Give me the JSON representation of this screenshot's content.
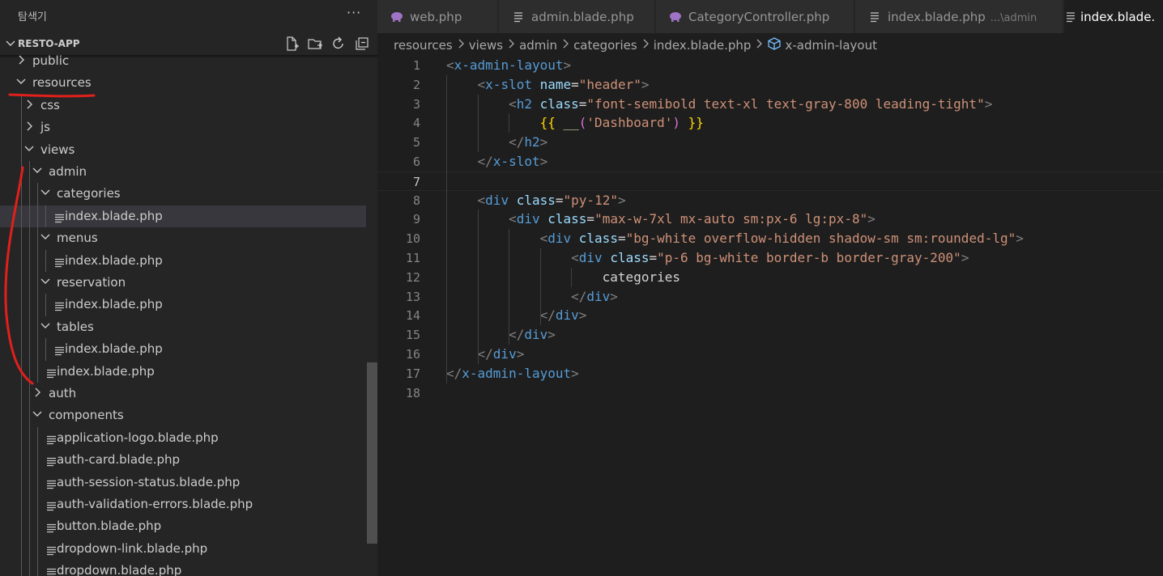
{
  "sidebar": {
    "explorer_title": "탐색기",
    "more_actions": "···",
    "project_name": "RESTO-APP",
    "project_actions": [
      "new-file-icon",
      "new-folder-icon",
      "refresh-icon",
      "collapse-all-icon"
    ],
    "tree": [
      {
        "label": "public",
        "type": "folder",
        "expanded": false,
        "depth": 0
      },
      {
        "label": "resources",
        "type": "folder",
        "expanded": true,
        "depth": 0
      },
      {
        "label": "css",
        "type": "folder",
        "expanded": false,
        "depth": 1
      },
      {
        "label": "js",
        "type": "folder",
        "expanded": false,
        "depth": 1
      },
      {
        "label": "views",
        "type": "folder",
        "expanded": true,
        "depth": 1
      },
      {
        "label": "admin",
        "type": "folder",
        "expanded": true,
        "depth": 2
      },
      {
        "label": "categories",
        "type": "folder",
        "expanded": true,
        "depth": 3
      },
      {
        "label": "index.blade.php",
        "type": "file",
        "depth": 4,
        "selected": true
      },
      {
        "label": "menus",
        "type": "folder",
        "expanded": true,
        "depth": 3
      },
      {
        "label": "index.blade.php",
        "type": "file",
        "depth": 4
      },
      {
        "label": "reservation",
        "type": "folder",
        "expanded": true,
        "depth": 3
      },
      {
        "label": "index.blade.php",
        "type": "file",
        "depth": 4
      },
      {
        "label": "tables",
        "type": "folder",
        "expanded": true,
        "depth": 3
      },
      {
        "label": "index.blade.php",
        "type": "file",
        "depth": 4
      },
      {
        "label": "index.blade.php",
        "type": "file",
        "depth": 3
      },
      {
        "label": "auth",
        "type": "folder",
        "expanded": false,
        "depth": 2
      },
      {
        "label": "components",
        "type": "folder",
        "expanded": true,
        "depth": 2
      },
      {
        "label": "application-logo.blade.php",
        "type": "file",
        "depth": 3
      },
      {
        "label": "auth-card.blade.php",
        "type": "file",
        "depth": 3
      },
      {
        "label": "auth-session-status.blade.php",
        "type": "file",
        "depth": 3
      },
      {
        "label": "auth-validation-errors.blade.php",
        "type": "file",
        "depth": 3
      },
      {
        "label": "button.blade.php",
        "type": "file",
        "depth": 3
      },
      {
        "label": "dropdown-link.blade.php",
        "type": "file",
        "depth": 3
      },
      {
        "label": "dropdown.blade.php",
        "type": "file",
        "depth": 3
      }
    ]
  },
  "tabs": [
    {
      "label": "web.php",
      "icon": "php-elephant-icon",
      "description": "",
      "active": false
    },
    {
      "label": "admin.blade.php",
      "icon": "file-lines-icon",
      "description": "",
      "active": false
    },
    {
      "label": "CategoryController.php",
      "icon": "php-elephant-icon",
      "description": "",
      "active": false
    },
    {
      "label": "index.blade.php",
      "icon": "file-lines-icon",
      "description": "...\\admin",
      "active": false
    },
    {
      "label": "index.blade.",
      "icon": "file-lines-icon",
      "description": "",
      "active": true
    }
  ],
  "breadcrumb": {
    "parts": [
      "resources",
      "views",
      "admin",
      "categories",
      "index.blade.php"
    ],
    "symbol": "x-admin-layout",
    "symbol_icon": "cube-symbol-icon"
  },
  "editor": {
    "current_line": 7,
    "lines": [
      {
        "n": "1",
        "tokens": [
          [
            "br",
            "<"
          ],
          [
            "tag",
            "x-admin-layout"
          ],
          [
            "br",
            ">"
          ]
        ]
      },
      {
        "n": "2",
        "tokens": [
          [
            "text",
            "    "
          ],
          [
            "br",
            "<"
          ],
          [
            "tag",
            "x-slot"
          ],
          [
            "text",
            " "
          ],
          [
            "attr",
            "name"
          ],
          [
            "eq",
            "="
          ],
          [
            "str",
            "\"header\""
          ],
          [
            "br",
            ">"
          ]
        ]
      },
      {
        "n": "3",
        "tokens": [
          [
            "text",
            "        "
          ],
          [
            "br",
            "<"
          ],
          [
            "tag",
            "h2"
          ],
          [
            "text",
            " "
          ],
          [
            "attr",
            "class"
          ],
          [
            "eq",
            "="
          ],
          [
            "str",
            "\"font-semibold text-xl text-gray-800 leading-tight\""
          ],
          [
            "br",
            ">"
          ]
        ]
      },
      {
        "n": "4",
        "tokens": [
          [
            "text",
            "            "
          ],
          [
            "blade",
            "{{"
          ],
          [
            "text",
            " "
          ],
          [
            "fn",
            "__"
          ],
          [
            "paren",
            "("
          ],
          [
            "str",
            "'Dashboard'"
          ],
          [
            "paren",
            ")"
          ],
          [
            "text",
            " "
          ],
          [
            "blade",
            "}}"
          ]
        ]
      },
      {
        "n": "5",
        "tokens": [
          [
            "text",
            "        "
          ],
          [
            "br",
            "</"
          ],
          [
            "tag",
            "h2"
          ],
          [
            "br",
            ">"
          ]
        ]
      },
      {
        "n": "6",
        "tokens": [
          [
            "text",
            "    "
          ],
          [
            "br",
            "</"
          ],
          [
            "tag",
            "x-slot"
          ],
          [
            "br",
            ">"
          ]
        ]
      },
      {
        "n": "7",
        "tokens": []
      },
      {
        "n": "8",
        "tokens": [
          [
            "text",
            "    "
          ],
          [
            "br",
            "<"
          ],
          [
            "tag",
            "div"
          ],
          [
            "text",
            " "
          ],
          [
            "attr",
            "class"
          ],
          [
            "eq",
            "="
          ],
          [
            "str",
            "\"py-12\""
          ],
          [
            "br",
            ">"
          ]
        ]
      },
      {
        "n": "9",
        "tokens": [
          [
            "text",
            "        "
          ],
          [
            "br",
            "<"
          ],
          [
            "tag",
            "div"
          ],
          [
            "text",
            " "
          ],
          [
            "attr",
            "class"
          ],
          [
            "eq",
            "="
          ],
          [
            "str",
            "\"max-w-7xl mx-auto sm:px-6 lg:px-8\""
          ],
          [
            "br",
            ">"
          ]
        ]
      },
      {
        "n": "10",
        "tokens": [
          [
            "text",
            "            "
          ],
          [
            "br",
            "<"
          ],
          [
            "tag",
            "div"
          ],
          [
            "text",
            " "
          ],
          [
            "attr",
            "class"
          ],
          [
            "eq",
            "="
          ],
          [
            "str",
            "\"bg-white overflow-hidden shadow-sm sm:rounded-lg\""
          ],
          [
            "br",
            ">"
          ]
        ]
      },
      {
        "n": "11",
        "tokens": [
          [
            "text",
            "                "
          ],
          [
            "br",
            "<"
          ],
          [
            "tag",
            "div"
          ],
          [
            "text",
            " "
          ],
          [
            "attr",
            "class"
          ],
          [
            "eq",
            "="
          ],
          [
            "str",
            "\"p-6 bg-white border-b border-gray-200\""
          ],
          [
            "br",
            ">"
          ]
        ]
      },
      {
        "n": "12",
        "tokens": [
          [
            "text",
            "                    categories"
          ]
        ]
      },
      {
        "n": "13",
        "tokens": [
          [
            "text",
            "                "
          ],
          [
            "br",
            "</"
          ],
          [
            "tag",
            "div"
          ],
          [
            "br",
            ">"
          ]
        ]
      },
      {
        "n": "14",
        "tokens": [
          [
            "text",
            "            "
          ],
          [
            "br",
            "</"
          ],
          [
            "tag",
            "div"
          ],
          [
            "br",
            ">"
          ]
        ]
      },
      {
        "n": "15",
        "tokens": [
          [
            "text",
            "        "
          ],
          [
            "br",
            "</"
          ],
          [
            "tag",
            "div"
          ],
          [
            "br",
            ">"
          ]
        ]
      },
      {
        "n": "16",
        "tokens": [
          [
            "text",
            "    "
          ],
          [
            "br",
            "</"
          ],
          [
            "tag",
            "div"
          ],
          [
            "br",
            ">"
          ]
        ]
      },
      {
        "n": "17",
        "tokens": [
          [
            "br",
            "</"
          ],
          [
            "tag",
            "x-admin-layout"
          ],
          [
            "br",
            ">"
          ]
        ]
      },
      {
        "n": "18",
        "tokens": []
      }
    ]
  },
  "colors": {
    "sidebar_bg": "#252526",
    "editor_bg": "#1e1e1e",
    "selected_row": "#37373d",
    "annotation_red": "#e0201b",
    "php_icon": "#a074c4"
  }
}
